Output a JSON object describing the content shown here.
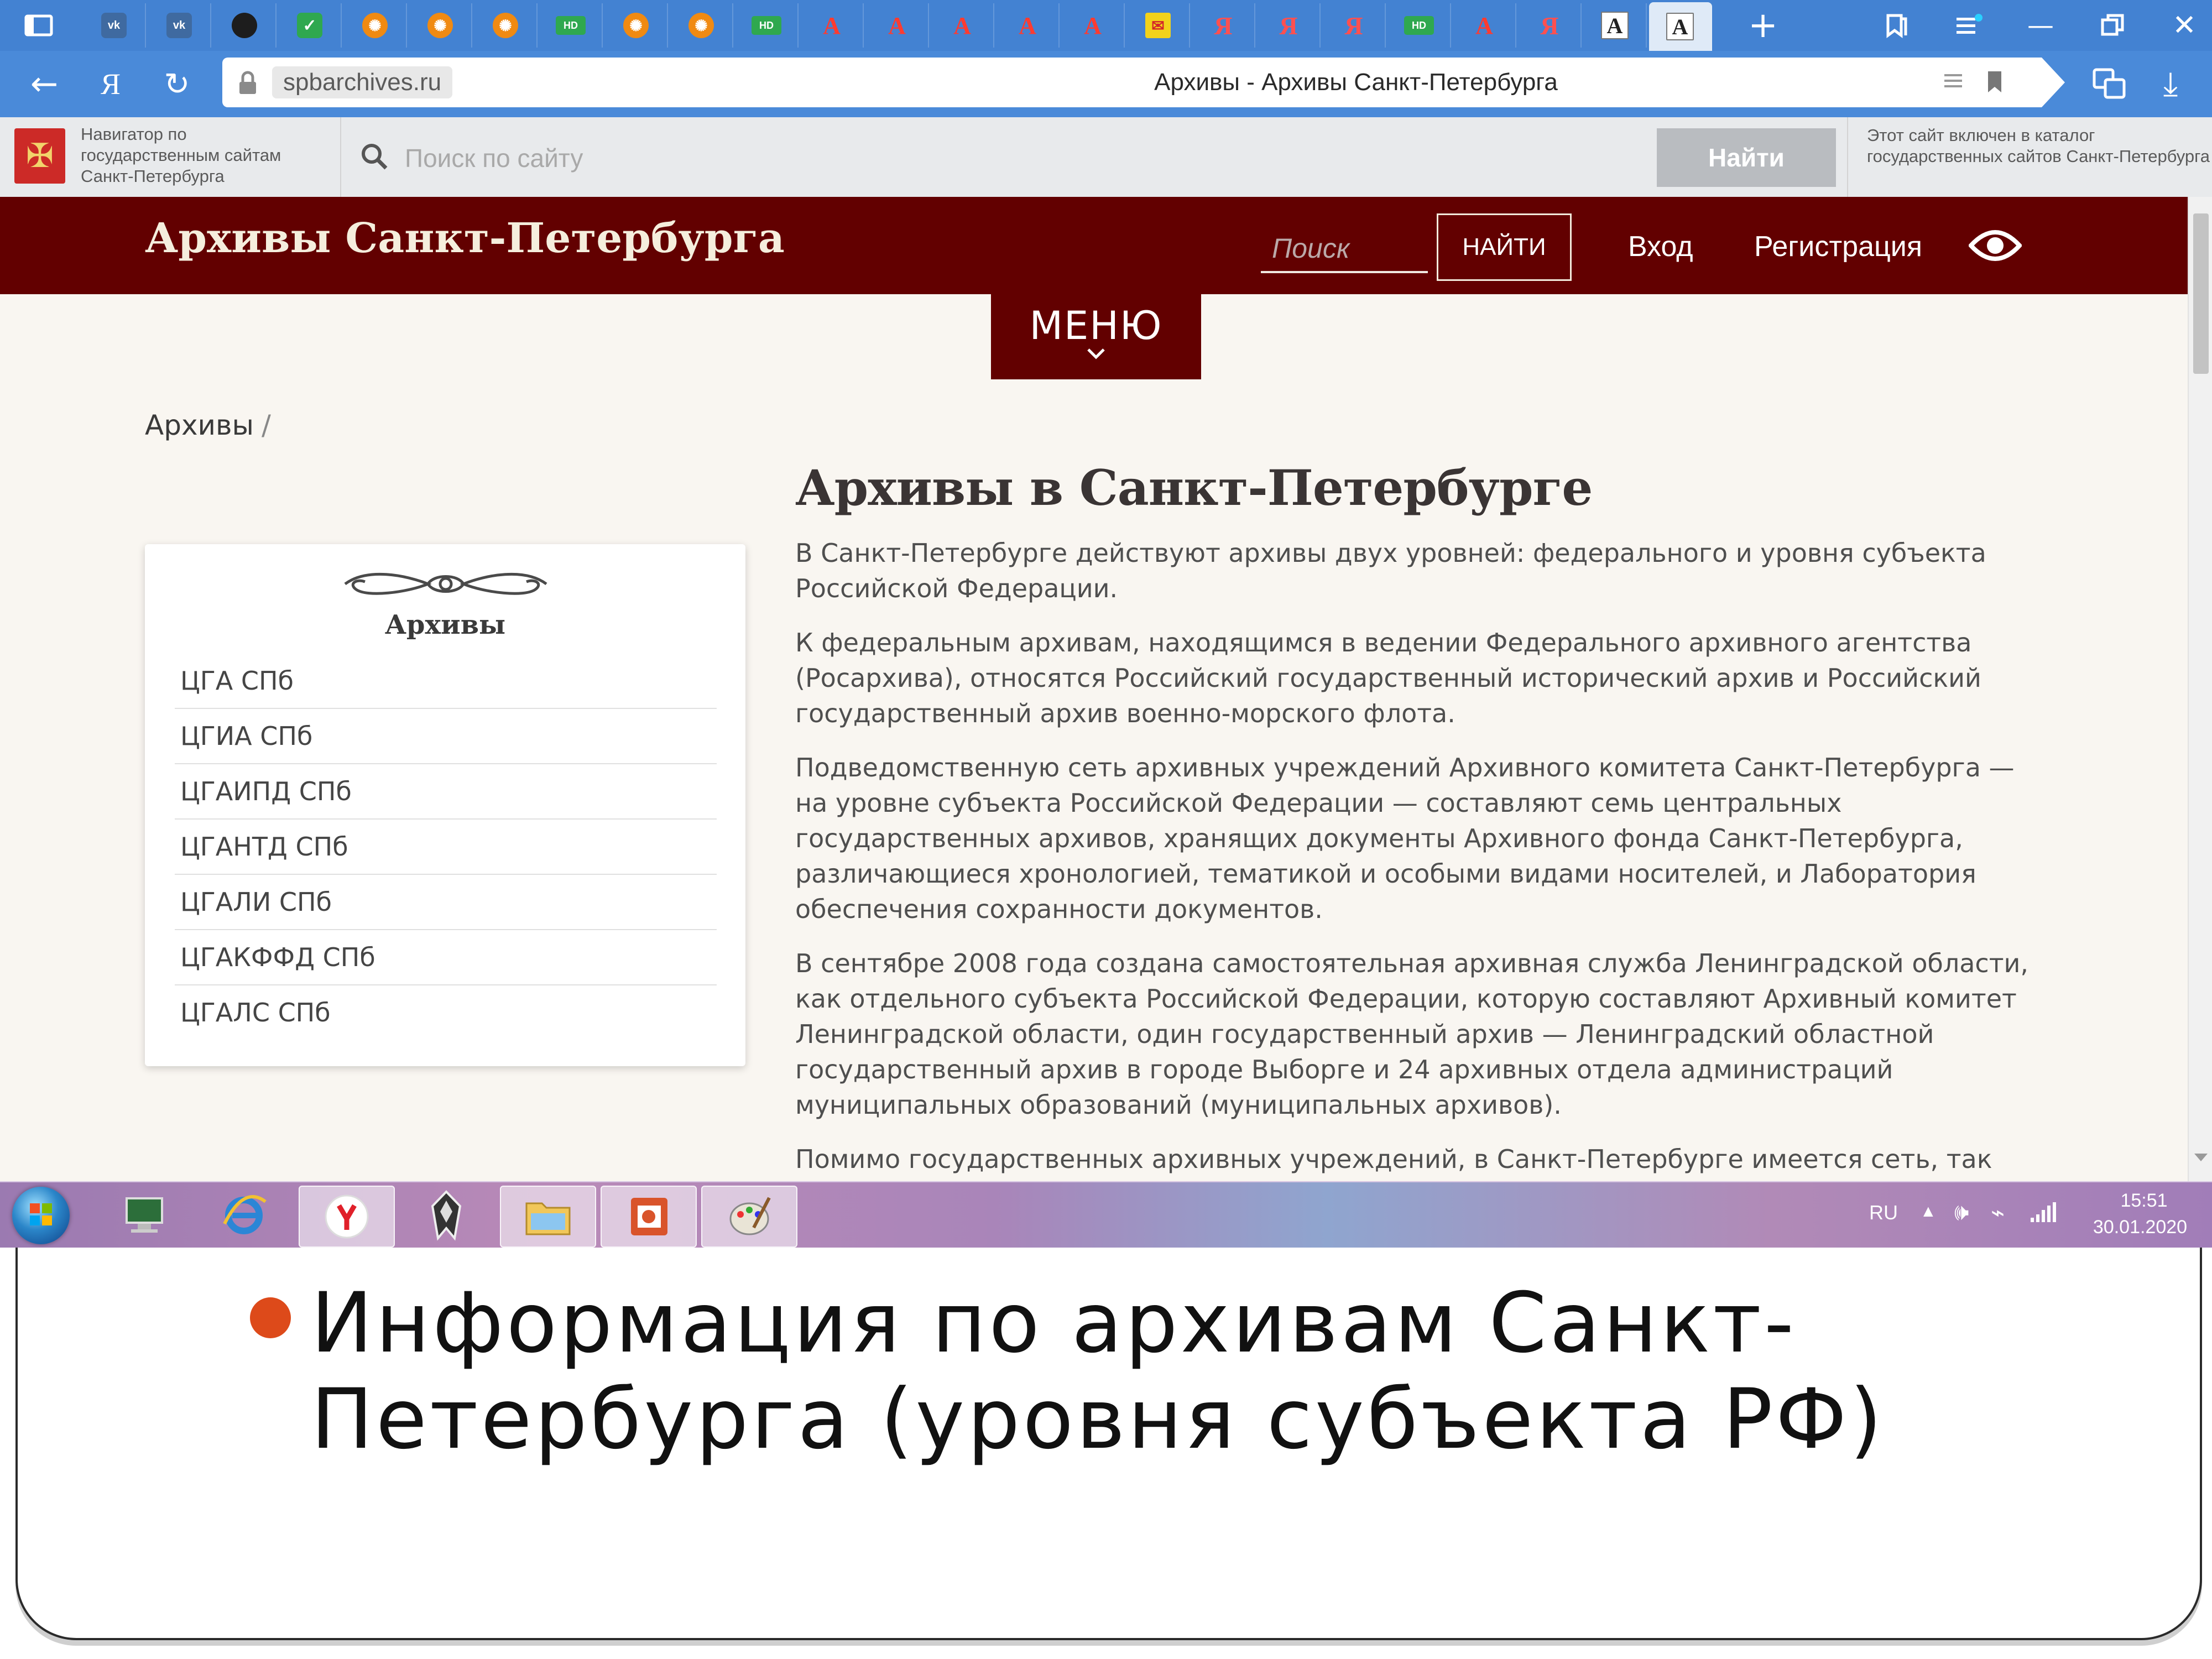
{
  "browser": {
    "url": "spbarchives.ru",
    "tab_title": "Архивы - Архивы Санкт-Петербурга",
    "tabs": [
      {
        "icon": "vk-icon",
        "glyph": "vk"
      },
      {
        "icon": "vk-icon",
        "glyph": "vk"
      },
      {
        "icon": "apple-icon",
        "glyph": ""
      },
      {
        "icon": "checkmark-icon",
        "glyph": "✓"
      },
      {
        "icon": "film-reel-icon",
        "glyph": "✺"
      },
      {
        "icon": "film-reel-icon",
        "glyph": "✺"
      },
      {
        "icon": "film-reel-icon",
        "glyph": "✺"
      },
      {
        "icon": "hd-icon",
        "glyph": "HD"
      },
      {
        "icon": "film-reel-icon",
        "glyph": "✺"
      },
      {
        "icon": "film-reel-icon",
        "glyph": "✺"
      },
      {
        "icon": "hd-icon",
        "glyph": "HD"
      },
      {
        "icon": "letter-a-icon",
        "glyph": "A"
      },
      {
        "icon": "letter-a-icon",
        "glyph": "A"
      },
      {
        "icon": "letter-a-icon",
        "glyph": "A"
      },
      {
        "icon": "letter-a-icon",
        "glyph": "A"
      },
      {
        "icon": "letter-a-icon",
        "glyph": "A"
      },
      {
        "icon": "mail-icon",
        "glyph": "✉"
      },
      {
        "icon": "yandex-icon",
        "glyph": "Я"
      },
      {
        "icon": "yandex-icon",
        "glyph": "Я"
      },
      {
        "icon": "yandex-icon",
        "glyph": "Я"
      },
      {
        "icon": "hd-icon",
        "glyph": "HD"
      },
      {
        "icon": "letter-a-icon",
        "glyph": "A"
      },
      {
        "icon": "yandex-icon",
        "glyph": "Я"
      },
      {
        "icon": "serif-a-icon",
        "glyph": "A"
      },
      {
        "icon": "serif-a-icon",
        "glyph": "A"
      }
    ],
    "yandex_letter": "Я"
  },
  "gov_bar": {
    "navigator_text": "Навигатор по государственным сайтам Санкт-Петербурга",
    "search_placeholder": "Поиск по сайту",
    "find_label": "Найти",
    "catalog_text": "Этот сайт включен в каталог государственных сайтов Санкт-Петербурга"
  },
  "header": {
    "site_title": "Архивы Санкт-Петербурга",
    "search_placeholder": "Поиск",
    "find_label": "НАЙТИ",
    "login_label": "Вход",
    "register_label": "Регистрация"
  },
  "menu": {
    "label": "МЕНЮ"
  },
  "breadcrumb": {
    "item": "Архивы",
    "separator": "/"
  },
  "sidebar": {
    "title": "Архивы",
    "items": [
      {
        "label": "ЦГА СПб"
      },
      {
        "label": "ЦГИА СПб"
      },
      {
        "label": "ЦГАИПД СПб"
      },
      {
        "label": "ЦГАНТД СПб"
      },
      {
        "label": "ЦГАЛИ СПб"
      },
      {
        "label": "ЦГАКФФД СПб"
      },
      {
        "label": "ЦГАЛС СПб"
      }
    ]
  },
  "article": {
    "title": "Архивы в Санкт-Петербурге",
    "paragraphs": [
      "В Санкт-Петербурге действуют архивы двух уровней: федерального и уровня субъекта Российской Федерации.",
      "К федеральным архивам, находящимся в ведении Федерального архивного агентства (Росархива), относятся Российский государственный исторический архив и Российский государственный архив военно-морского флота.",
      "Подведомственную сеть архивных учреждений Архивного комитета Санкт-Петербурга — на уровне субъекта Российской Федерации — составляют семь центральных государственных архивов, хранящих документы Архивного фонда Санкт-Петербурга, различающиеся хронологией, тематикой и особыми видами носителей, и Лаборатория обеспечения сохранности документов.",
      "В сентябре 2008 года создана самостоятельная архивная служба Ленинградской области, как отдельного субъекта Российской Федерации, которую составляют Архивный комитет Ленинградской области, один государственный архив — Ленинградский областной государственный архив в городе Выборге и 24 архивных отдела администраций муниципальных образований (муниципальных архивов).",
      "Помимо государственных архивных учреждений, в Санкт-Петербурге имеется сеть, так"
    ]
  },
  "taskbar": {
    "language": "RU",
    "time": "15:51",
    "date": "30.01.2020"
  },
  "slide": {
    "caption": "Информация по архивам Санкт-Петербурга (уровня субъекта РФ)"
  }
}
